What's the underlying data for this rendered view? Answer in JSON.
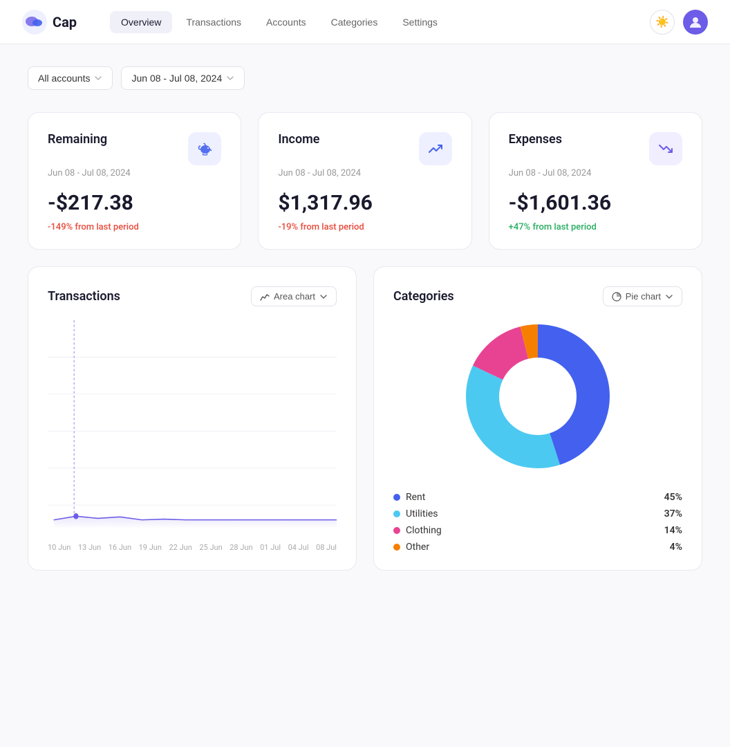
{
  "logo": {
    "text": "Cap"
  },
  "nav": {
    "links": [
      {
        "id": "overview",
        "label": "Overview",
        "active": true
      },
      {
        "id": "transactions",
        "label": "Transactions",
        "active": false
      },
      {
        "id": "accounts",
        "label": "Accounts",
        "active": false
      },
      {
        "id": "categories",
        "label": "Categories",
        "active": false
      },
      {
        "id": "settings",
        "label": "Settings",
        "active": false
      }
    ]
  },
  "filters": {
    "accounts_label": "All accounts",
    "date_range_label": "Jun 08 - Jul 08, 2024"
  },
  "cards": [
    {
      "id": "remaining",
      "title": "Remaining",
      "date": "Jun 08 - Jul 08, 2024",
      "amount": "-$217.38",
      "change": "-149% from last period",
      "change_type": "negative",
      "icon": "💰",
      "icon_class": "blue"
    },
    {
      "id": "income",
      "title": "Income",
      "date": "Jun 08 - Jul 08, 2024",
      "amount": "$1,317.96",
      "change": "-19% from last period",
      "change_type": "negative",
      "icon": "📈",
      "icon_class": "green"
    },
    {
      "id": "expenses",
      "title": "Expenses",
      "date": "Jun 08 - Jul 08, 2024",
      "amount": "-$1,601.36",
      "change": "+47% from last period",
      "change_type": "positive",
      "icon": "📉",
      "icon_class": "red"
    }
  ],
  "transactions_chart": {
    "title": "Transactions",
    "chart_type": "Area chart",
    "x_labels": [
      "10 Jun",
      "13 Jun",
      "16 Jun",
      "19 Jun",
      "22 Jun",
      "25 Jun",
      "28 Jun",
      "01 Jul",
      "04 Jul",
      "08 Jul"
    ]
  },
  "categories_chart": {
    "title": "Categories",
    "chart_type": "Pie chart",
    "legend": [
      {
        "label": "Rent",
        "pct": "45%",
        "color": "#4361ee"
      },
      {
        "label": "Utilities",
        "pct": "37%",
        "color": "#4cc9f0"
      },
      {
        "label": "Clothing",
        "pct": "14%",
        "color": "#e84393"
      },
      {
        "label": "Other",
        "pct": "4%",
        "color": "#f77f00"
      }
    ],
    "pie_segments": [
      {
        "label": "Rent",
        "value": 45,
        "color": "#4361ee"
      },
      {
        "label": "Utilities",
        "value": 37,
        "color": "#4cc9f0"
      },
      {
        "label": "Clothing",
        "value": 14,
        "color": "#e84393"
      },
      {
        "label": "Other",
        "value": 4,
        "color": "#f77f00"
      }
    ]
  }
}
